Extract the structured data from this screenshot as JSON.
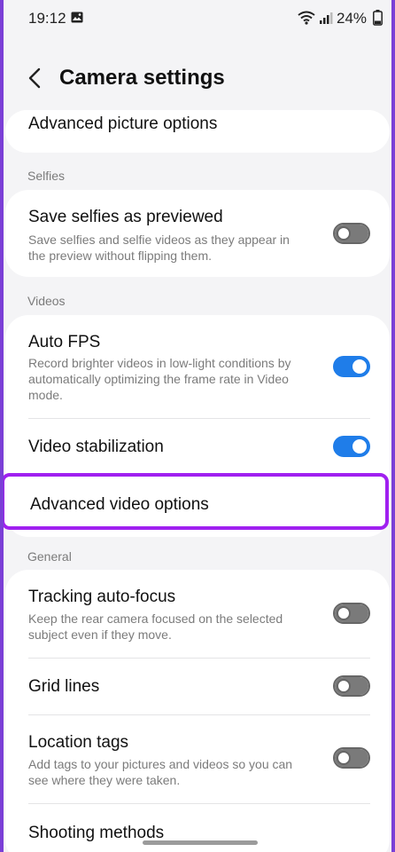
{
  "status": {
    "time": "19:12",
    "battery": "24%"
  },
  "header": {
    "title": "Camera settings"
  },
  "top_item": {
    "label": "Advanced picture options"
  },
  "sections": {
    "selfies": {
      "label": "Selfies",
      "items": [
        {
          "title": "Save selfies as previewed",
          "subtitle": "Save selfies and selfie videos as they appear in the preview without flipping them.",
          "toggle": false
        }
      ]
    },
    "videos": {
      "label": "Videos",
      "items": [
        {
          "title": "Auto FPS",
          "subtitle": "Record brighter videos in low-light conditions by automatically optimizing the frame rate in Video mode.",
          "toggle": true
        },
        {
          "title": "Video stabilization",
          "toggle": true
        },
        {
          "title": "Advanced video options"
        }
      ]
    },
    "general": {
      "label": "General",
      "items": [
        {
          "title": "Tracking auto-focus",
          "subtitle": "Keep the rear camera focused on the selected subject even if they move.",
          "toggle": false
        },
        {
          "title": "Grid lines",
          "toggle": false
        },
        {
          "title": "Location tags",
          "subtitle": "Add tags to your pictures and videos so you can see where they were taken.",
          "toggle": false
        },
        {
          "title": "Shooting methods"
        }
      ]
    }
  },
  "colors": {
    "accent": "#1f7de9",
    "highlight": "#a020f0",
    "frame": "#7b3fd6"
  }
}
